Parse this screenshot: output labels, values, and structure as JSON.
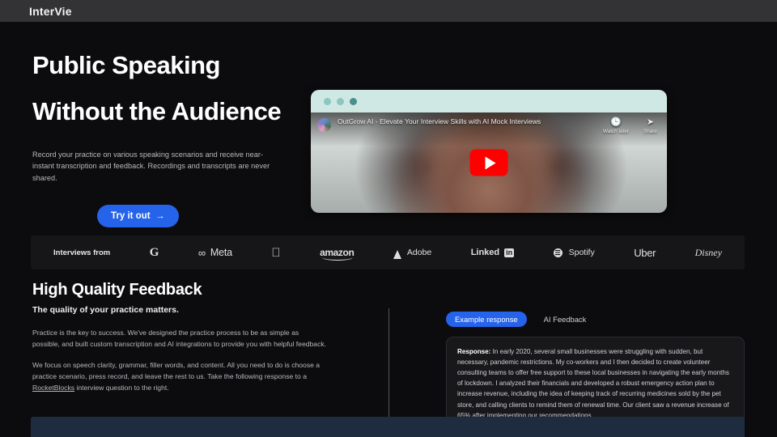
{
  "topbar": {
    "brand": "InterVie"
  },
  "hero": {
    "headline_line1": "Public Speaking",
    "headline_line2": "Without the Audience",
    "subtitle": "Record your practice on various speaking scenarios and receive near-instant transcription and feedback. Recordings and transcripts are never shared.",
    "cta_label": "Try it out",
    "cta_arrow": "→"
  },
  "video": {
    "title": "OutGrow AI - Elevate Your Interview Skills with AI Mock Interviews",
    "watch_later_label": "Watch later",
    "watch_later_icon": "🕒",
    "share_label": "Share",
    "share_icon": "➤",
    "play_icon": "play-button"
  },
  "logos": {
    "label": "Interviews from",
    "items": [
      {
        "name": "Google",
        "text": "G"
      },
      {
        "name": "Meta",
        "text": "Meta"
      },
      {
        "name": "Apple",
        "text": ""
      },
      {
        "name": "Amazon",
        "text": "amazon"
      },
      {
        "name": "Adobe",
        "text": "Adobe"
      },
      {
        "name": "LinkedIn",
        "text": "Linked"
      },
      {
        "name": "LinkedIn-badge",
        "text": "in"
      },
      {
        "name": "Spotify",
        "text": "Spotify"
      },
      {
        "name": "Uber",
        "text": "Uber"
      },
      {
        "name": "Disney",
        "text": "Disney"
      }
    ]
  },
  "feedback": {
    "title": "High Quality Feedback",
    "subtitle": "The quality of your practice matters.",
    "paragraph1": "Practice is the key to success. We've designed the practice process to be as simple as possible, and built custom transcription and AI integrations to provide you with helpful feedback.",
    "paragraph2_before": "We focus on speech clarity, grammar, filler words, and content. All you need to do is choose a practice scenario, press record, and leave the rest to us. Take the following response to a ",
    "paragraph2_link": "RocketBlocks",
    "paragraph2_after": " interview question to the right.",
    "tabs": [
      {
        "label": "Example response",
        "active": true
      },
      {
        "label": "AI Feedback",
        "active": false
      }
    ],
    "response_label": "Response:",
    "response_body": " In early 2020, several small businesses were struggling with sudden, but necessary, pandemic restrictions. My co-workers and I then decided to create volunteer consulting teams to offer free support to these local businesses in navigating the early months of lockdown. I analyzed their financials and developed a robust emergency action plan to increase revenue, including the idea of keeping track of recurring medicines sold by the pet store, and calling clients to remind them of renewal time. Our client saw a revenue increase of 65% after implementing our recommendations."
  },
  "colors": {
    "accent_blue": "#2563eb",
    "page_background": "#0c0c0e",
    "topbar_background": "#333336",
    "video_chrome": "#cfe8e4",
    "bottom_band": "#1f2b3f"
  }
}
